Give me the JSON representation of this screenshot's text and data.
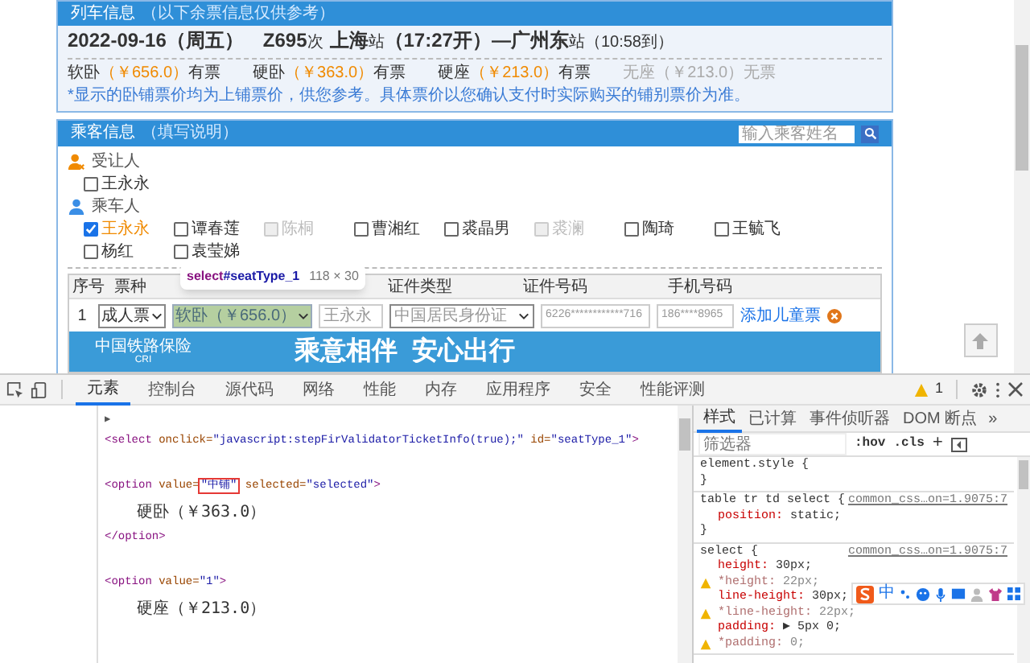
{
  "train_info": {
    "title": "列车信息",
    "subtitle": "（以下余票信息仅供参考）",
    "date": "2022-09-16（周五）",
    "train_no": "Z695",
    "train_suffix": "次",
    "from": "上海",
    "from_suffix": "站",
    "depart": "（17:27开）—",
    "to": "广州东",
    "to_suffix": "站",
    "arrive": "（10:58到）",
    "seats": [
      {
        "name": "软卧",
        "price": "（￥656.0）",
        "status": "有票",
        "available": true
      },
      {
        "name": "硬卧",
        "price": "（￥363.0）",
        "status": "有票",
        "available": true
      },
      {
        "name": "硬座",
        "price": "（￥213.0）",
        "status": "有票",
        "available": true
      },
      {
        "name": "无座",
        "price": "（￥213.0）",
        "status": "无票",
        "available": false
      }
    ],
    "note": "*显示的卧铺票价均为上铺票价，供您参考。具体票价以您确认支付时实际购买的铺别票价为准。"
  },
  "passenger_info": {
    "title": "乘客信息",
    "subtitle": "（填写说明）",
    "search": {
      "placeholder": "输入乘客姓名"
    },
    "groups": [
      {
        "kind": "transferee",
        "label": "受让人",
        "people": [
          {
            "name": "王永永",
            "checked": false,
            "disabled": false
          }
        ]
      },
      {
        "kind": "rider",
        "label": "乘车人",
        "people": [
          {
            "name": "王永永",
            "checked": true,
            "disabled": false
          },
          {
            "name": "谭春莲",
            "checked": false,
            "disabled": false
          },
          {
            "name": "陈桐",
            "checked": false,
            "disabled": true
          },
          {
            "name": "曹湘红",
            "checked": false,
            "disabled": false
          },
          {
            "name": "裘晶男",
            "checked": false,
            "disabled": false
          },
          {
            "name": "裘澜",
            "checked": false,
            "disabled": true
          },
          {
            "name": "陶琦",
            "checked": false,
            "disabled": false
          },
          {
            "name": "王毓飞",
            "checked": false,
            "disabled": false
          },
          {
            "name": "杨红",
            "checked": false,
            "disabled": false
          },
          {
            "name": "袁莹娣",
            "checked": false,
            "disabled": false
          }
        ]
      }
    ],
    "table": {
      "columns": [
        "序号",
        "票种",
        "证件类型",
        "证件号码",
        "手机号码"
      ],
      "rows": [
        {
          "index": "1",
          "ticket_type": "成人票",
          "seat": "软卧（￥656.0）",
          "name": "王永永",
          "id_type": "中国居民身份证",
          "id_number": "6226************716",
          "phone": "186****8965",
          "link": "添加儿童票"
        }
      ]
    },
    "banner": {
      "brand": "中国铁路保险",
      "brand_sub": "CRI",
      "slogan": "乘意相伴  安心出行"
    }
  },
  "inspector_tooltip": {
    "selector_tag": "select",
    "selector_id": "#seatType_1",
    "size": "118 × 30"
  },
  "devtools": {
    "tabs": [
      {
        "label": "元素",
        "selected": true
      },
      {
        "label": "控制台",
        "selected": false
      },
      {
        "label": "源代码",
        "selected": false
      },
      {
        "label": "网络",
        "selected": false
      },
      {
        "label": "性能",
        "selected": false
      },
      {
        "label": "内存",
        "selected": false
      },
      {
        "label": "应用程序",
        "selected": false
      },
      {
        "label": "安全",
        "selected": false
      },
      {
        "label": "性能评测",
        "selected": false
      }
    ],
    "warnings": "1",
    "code_blocks": [
      [
        {
          "kind": "toggle",
          "text": "▶"
        },
        {
          "kind": "tag",
          "tokens": [
            {
              "kind": "tag",
              "text": "<select"
            },
            {
              "kind": "attr",
              "text": " onclick="
            },
            {
              "kind": "value",
              "text": "\"javascript:stepFirValidatorTicketInfo(true);\""
            },
            {
              "kind": "attr",
              "text": " id="
            },
            {
              "kind": "value",
              "text": "\"seatType_1\""
            },
            {
              "kind": "tag",
              "text": ">"
            }
          ]
        }
      ],
      [
        {
          "kind": "tag",
          "tokens": [
            {
              "kind": "tag",
              "text": "<option"
            },
            {
              "kind": "attr",
              "text": " value="
            },
            {
              "kind": "boxed",
              "text": "\"中铺\""
            },
            {
              "kind": "attr",
              "text": " selected="
            },
            {
              "kind": "value",
              "text": "\"selected\""
            },
            {
              "kind": "tag",
              "text": ">"
            }
          ]
        },
        {
          "kind": "text",
          "text": "硬卧（￥363.0）"
        },
        {
          "kind": "tag",
          "tokens": [
            {
              "kind": "tag",
              "text": "</option>"
            }
          ]
        }
      ],
      [
        {
          "kind": "tag",
          "tokens": [
            {
              "kind": "tag",
              "text": "<option"
            },
            {
              "kind": "attr",
              "text": " value="
            },
            {
              "kind": "value",
              "text": "\"1\""
            },
            {
              "kind": "tag",
              "text": ">"
            }
          ]
        },
        {
          "kind": "text",
          "text": "硬座（￥213.0）"
        }
      ]
    ],
    "style_tabs": [
      {
        "label": "样式",
        "selected": true
      },
      {
        "label": "已计算",
        "selected": false
      },
      {
        "label": "事件侦听器",
        "selected": false
      },
      {
        "label": "DOM 断点",
        "selected": false
      }
    ],
    "more": "»",
    "filter": {
      "placeholder": "筛选器"
    },
    "hov": ":hov",
    "cls": ".cls",
    "plus": "+",
    "rules": [
      {
        "selector": "element.style {",
        "close": "}"
      },
      {
        "selector": "table tr td select {",
        "source": "common_css…on=1.9075:7",
        "decls": [
          {
            "prop": "position:",
            "value": "static;",
            "warning": false,
            "struck": false
          }
        ],
        "close": "}"
      },
      {
        "selector": "select {",
        "source": "common_css…on=1.9075:7",
        "decls": [
          {
            "prop": "height:",
            "value": "30px;",
            "warning": false,
            "struck": false
          },
          {
            "prop": "*height:",
            "value": "22px;",
            "warning": true,
            "struck": true
          },
          {
            "prop": "line-height:",
            "value": "30px;",
            "warning": false,
            "struck": false
          },
          {
            "prop": "*line-height:",
            "value": "22px;",
            "warning": true,
            "struck": true
          },
          {
            "prop": "padding:",
            "value": "▶ 5px 0;",
            "warning": false,
            "struck": false
          },
          {
            "prop": "*padding:",
            "value": "0;",
            "warning": true,
            "struck": true
          }
        ]
      }
    ]
  },
  "ime_bar": {
    "mode": "中"
  }
}
